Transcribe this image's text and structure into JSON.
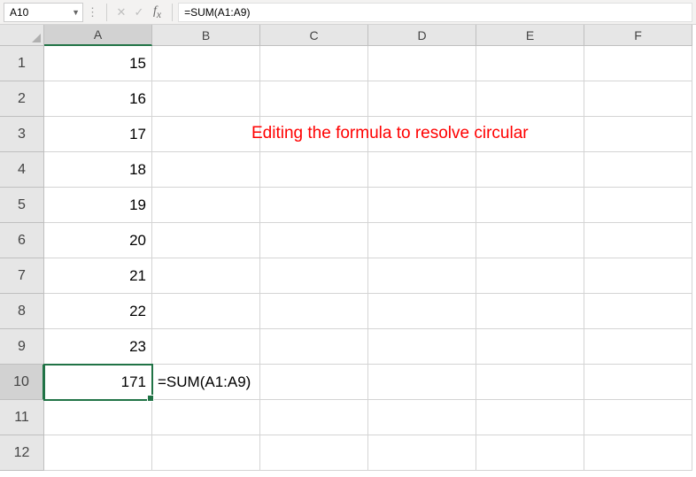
{
  "formula_bar": {
    "name_box": "A10",
    "formula": "=SUM(A1:A9)"
  },
  "columns": [
    "A",
    "B",
    "C",
    "D",
    "E",
    "F"
  ],
  "rows": [
    "1",
    "2",
    "3",
    "4",
    "5",
    "6",
    "7",
    "8",
    "9",
    "10",
    "11",
    "12"
  ],
  "cells": {
    "A1": "15",
    "A2": "16",
    "A3": "17",
    "A4": "18",
    "A5": "19",
    "A6": "20",
    "A7": "21",
    "A8": "22",
    "A9": "23",
    "A10": "171",
    "B10": "=SUM(A1:A9)"
  },
  "annotation": "Editing the formula to resolve circular",
  "selected_cell": "A10",
  "chart_data": {
    "type": "table",
    "columns": [
      "A"
    ],
    "rows": [
      15,
      16,
      17,
      18,
      19,
      20,
      21,
      22,
      23
    ],
    "sum_formula": "=SUM(A1:A9)",
    "sum_result": 171
  }
}
